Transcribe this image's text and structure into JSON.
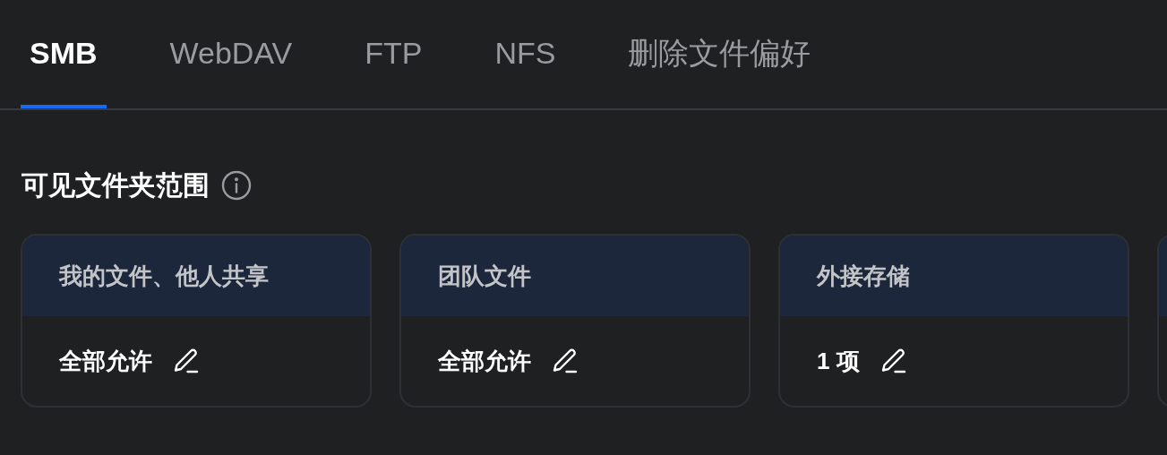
{
  "tabs": [
    {
      "label": "SMB",
      "selected": true
    },
    {
      "label": "WebDAV",
      "selected": false
    },
    {
      "label": "FTP",
      "selected": false
    },
    {
      "label": "NFS",
      "selected": false
    },
    {
      "label": "删除文件偏好",
      "selected": false
    }
  ],
  "section": {
    "title": "可见文件夹范围"
  },
  "cards": [
    {
      "kind": "full",
      "title": "我的文件、他人共享",
      "value": "全部允许"
    },
    {
      "kind": "full",
      "title": "团队文件",
      "value": "全部允许"
    },
    {
      "kind": "full",
      "title": "外接存储",
      "value": "1 项"
    },
    {
      "kind": "cut"
    }
  ]
}
